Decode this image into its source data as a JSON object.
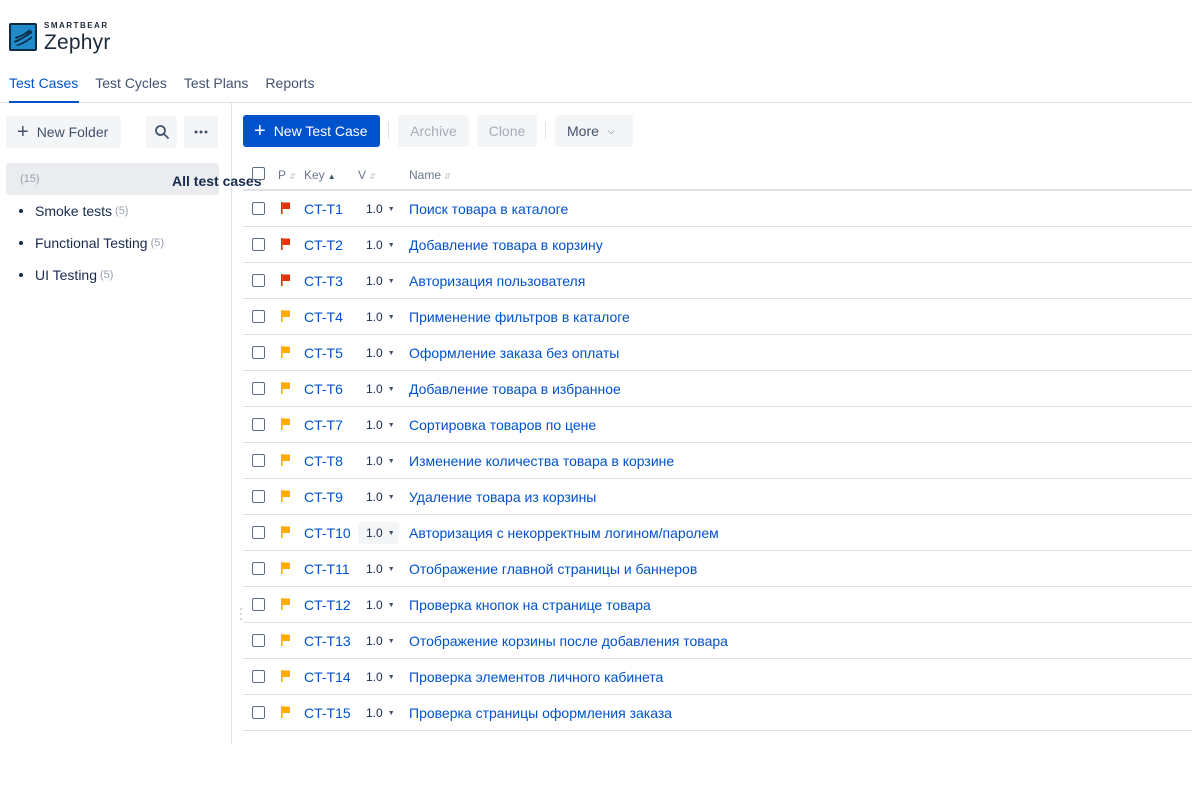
{
  "brand": {
    "small": "SMARTBEAR",
    "name": "Zephyr",
    "color": "#1f8cc9"
  },
  "tabs": [
    {
      "label": "Test Cases",
      "active": true
    },
    {
      "label": "Test Cycles",
      "active": false
    },
    {
      "label": "Test Plans",
      "active": false
    },
    {
      "label": "Reports",
      "active": false
    }
  ],
  "sidebar": {
    "new_folder_label": "New Folder",
    "all": {
      "label": "All test cases",
      "count": "(15)"
    },
    "folders": [
      {
        "label": "Smoke tests",
        "count": "(5)"
      },
      {
        "label": "Functional Testing",
        "count": "(5)"
      },
      {
        "label": "UI Testing",
        "count": "(5)"
      }
    ]
  },
  "toolbar": {
    "new_test_case": "New Test Case",
    "archive": "Archive",
    "clone": "Clone",
    "more": "More"
  },
  "table": {
    "headers": {
      "priority": "P",
      "key": "Key",
      "version": "V",
      "name": "Name"
    },
    "rows": [
      {
        "key": "CT-T1",
        "version": "1.0",
        "name": "Поиск товара в каталоге",
        "priority": "high"
      },
      {
        "key": "CT-T2",
        "version": "1.0",
        "name": "Добавление товара в корзину",
        "priority": "high"
      },
      {
        "key": "CT-T3",
        "version": "1.0",
        "name": "Авторизация пользователя",
        "priority": "high"
      },
      {
        "key": "CT-T4",
        "version": "1.0",
        "name": "Применение фильтров в каталоге",
        "priority": "normal"
      },
      {
        "key": "CT-T5",
        "version": "1.0",
        "name": "Оформление заказа без оплаты",
        "priority": "normal"
      },
      {
        "key": "CT-T6",
        "version": "1.0",
        "name": "Добавление товара в избранное",
        "priority": "normal"
      },
      {
        "key": "CT-T7",
        "version": "1.0",
        "name": "Сортировка товаров по цене",
        "priority": "normal"
      },
      {
        "key": "CT-T8",
        "version": "1.0",
        "name": "Изменение количества товара в корзине",
        "priority": "normal"
      },
      {
        "key": "CT-T9",
        "version": "1.0",
        "name": "Удаление товара из корзины",
        "priority": "normal"
      },
      {
        "key": "CT-T10",
        "version": "1.0",
        "name": "Авторизация с некорректным логином/паролем",
        "priority": "normal"
      },
      {
        "key": "CT-T11",
        "version": "1.0",
        "name": "Отображение главной страницы и баннеров",
        "priority": "normal"
      },
      {
        "key": "CT-T12",
        "version": "1.0",
        "name": "Проверка кнопок на странице товара",
        "priority": "normal"
      },
      {
        "key": "CT-T13",
        "version": "1.0",
        "name": "Отображение корзины после добавления товара",
        "priority": "normal"
      },
      {
        "key": "CT-T14",
        "version": "1.0",
        "name": "Проверка элементов личного кабинета",
        "priority": "normal"
      },
      {
        "key": "CT-T15",
        "version": "1.0",
        "name": "Проверка страницы оформления заказа",
        "priority": "normal"
      }
    ]
  },
  "colors": {
    "accent": "#0052cc",
    "flag_high": "#de350b",
    "flag_normal": "#ffab00"
  }
}
